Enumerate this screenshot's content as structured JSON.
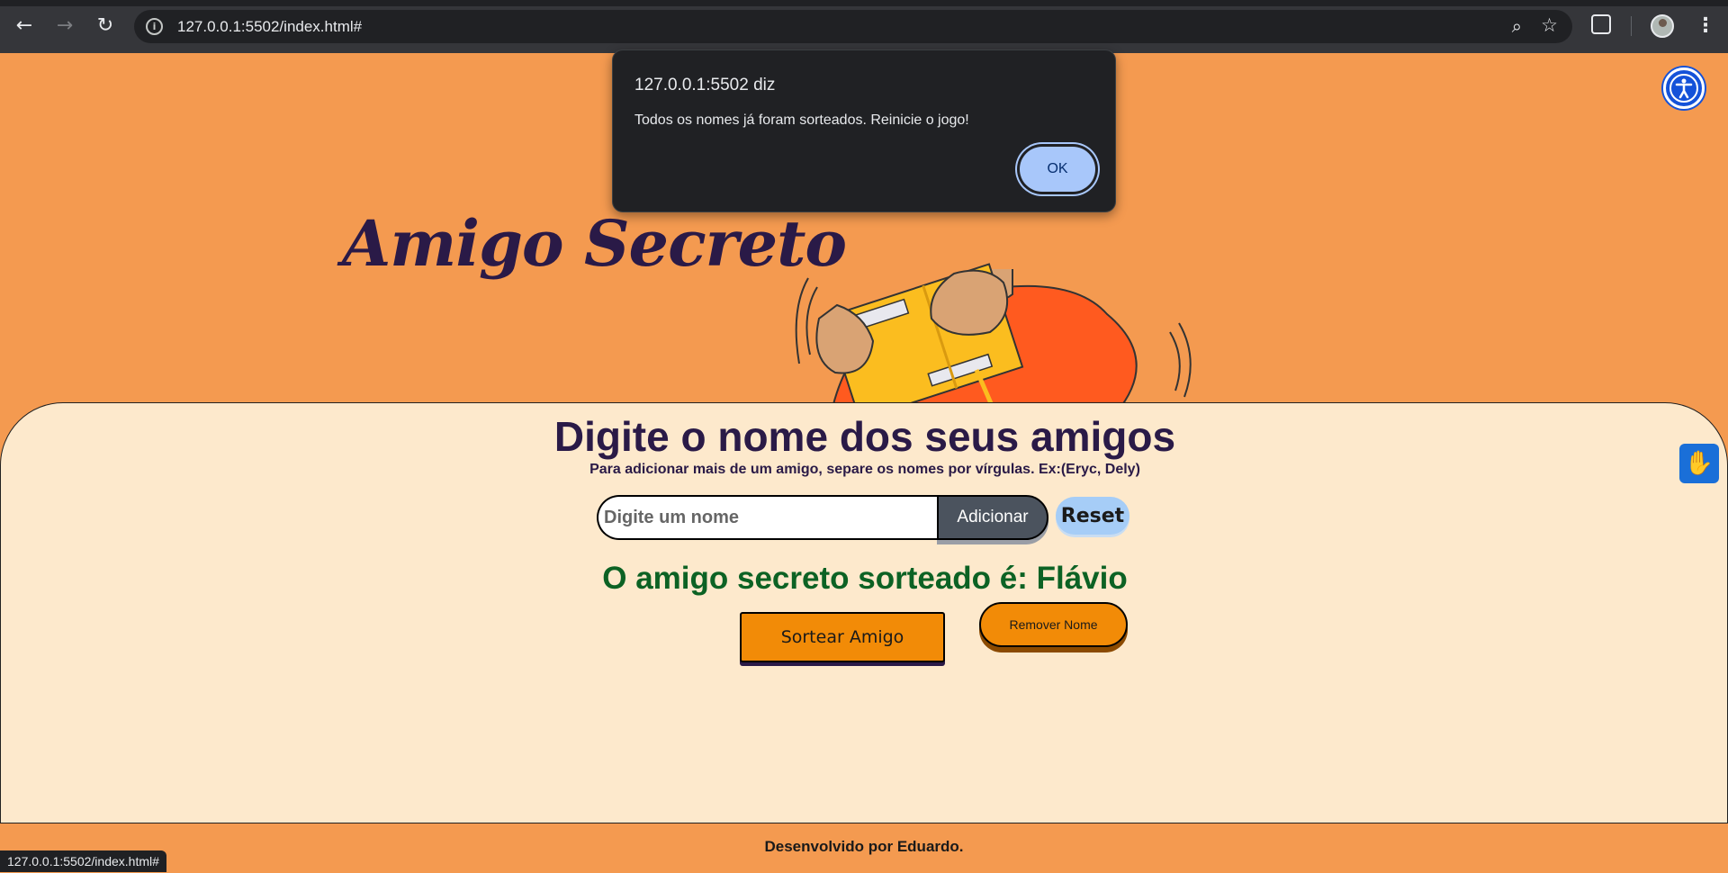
{
  "browser": {
    "url": "127.0.0.1:5502/index.html#",
    "status_url": "127.0.0.1:5502/index.html#"
  },
  "page": {
    "title": "Amigo Secreto",
    "heading": "Digite o nome dos seus amigos",
    "subheading": "Para adicionar mais de um amigo, separe os nomes por vírgulas. Ex:(Eryc, Dely)",
    "input_placeholder": "Digite um nome",
    "add_button": "Adicionar",
    "reset_button": "Reset",
    "result": "O amigo secreto sorteado é: Flávio",
    "draw_button": "Sortear Amigo",
    "remove_button": "Remover Nome",
    "footer": "Desenvolvido por Eduardo."
  },
  "dialog": {
    "title": "127.0.0.1:5502 diz",
    "message": "Todos os nomes já foram sorteados. Reinicie o jogo!",
    "ok_button": "OK"
  }
}
